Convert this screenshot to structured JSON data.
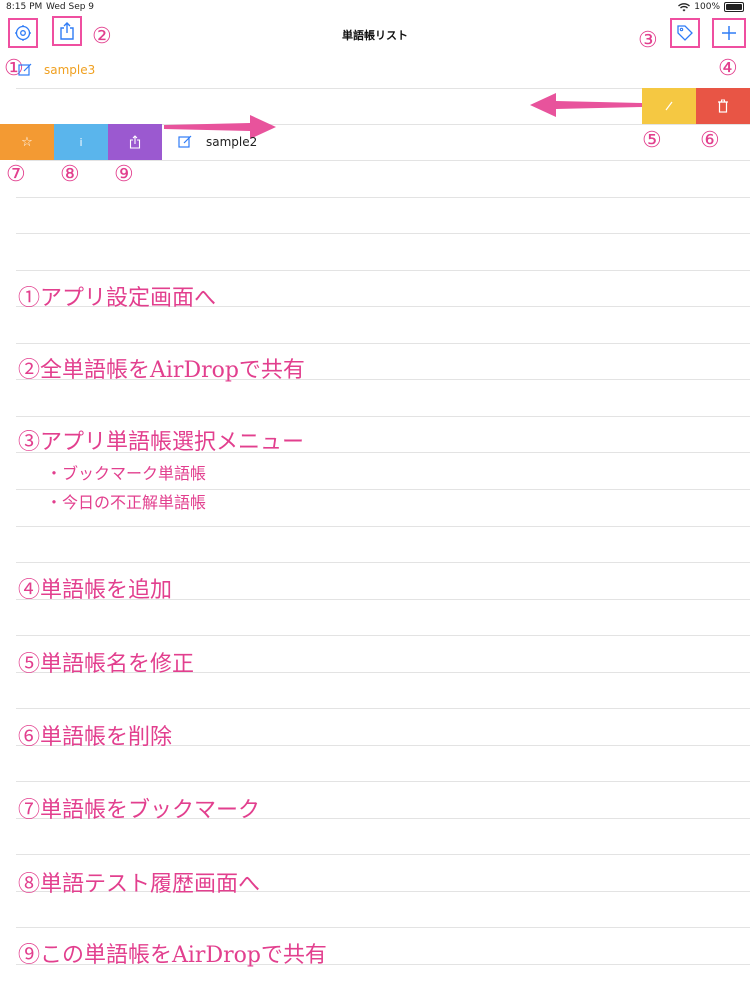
{
  "status_bar": {
    "time": "8:15 PM",
    "date": "Wed Sep 9",
    "battery": "100%"
  },
  "nav": {
    "title": "単語帳リスト"
  },
  "icons": {
    "settings": "settings-icon",
    "share_all": "share-icon",
    "tag": "tag-icon",
    "add": "plus-icon"
  },
  "markers": [
    "①",
    "②",
    "③",
    "④",
    "⑤",
    "⑥",
    "⑦",
    "⑧",
    "⑨"
  ],
  "rows": [
    {
      "name": "sample3",
      "color": "#f0a020"
    },
    {
      "name": "sample2",
      "color": "#222222"
    }
  ],
  "swipe_actions": {
    "right": [
      {
        "name": "edit",
        "color": "#f5c842"
      },
      {
        "name": "delete",
        "color": "#e85545"
      }
    ],
    "left": [
      {
        "name": "bookmark",
        "glyph": "☆",
        "color": "#f39a33"
      },
      {
        "name": "history",
        "glyph": "i",
        "color": "#5ab5ec"
      },
      {
        "name": "share",
        "color": "#9b59d0"
      }
    ]
  },
  "notes": [
    "①アプリ設定画面へ",
    "②全単語帳をAirDropで共有",
    "③アプリ単語帳選択メニュー",
    "・ブックマーク単語帳",
    "・今日の不正解単語帳",
    "④単語帳を追加",
    "⑤単語帳名を修正",
    "⑥単語帳を削除",
    "⑦単語帳をブックマーク",
    "⑧単語テスト履歴画面へ",
    "⑨この単語帳をAirDropで共有"
  ],
  "colors": {
    "accent_pink": "#e23f8e",
    "ios_blue": "#2f7cf6"
  }
}
